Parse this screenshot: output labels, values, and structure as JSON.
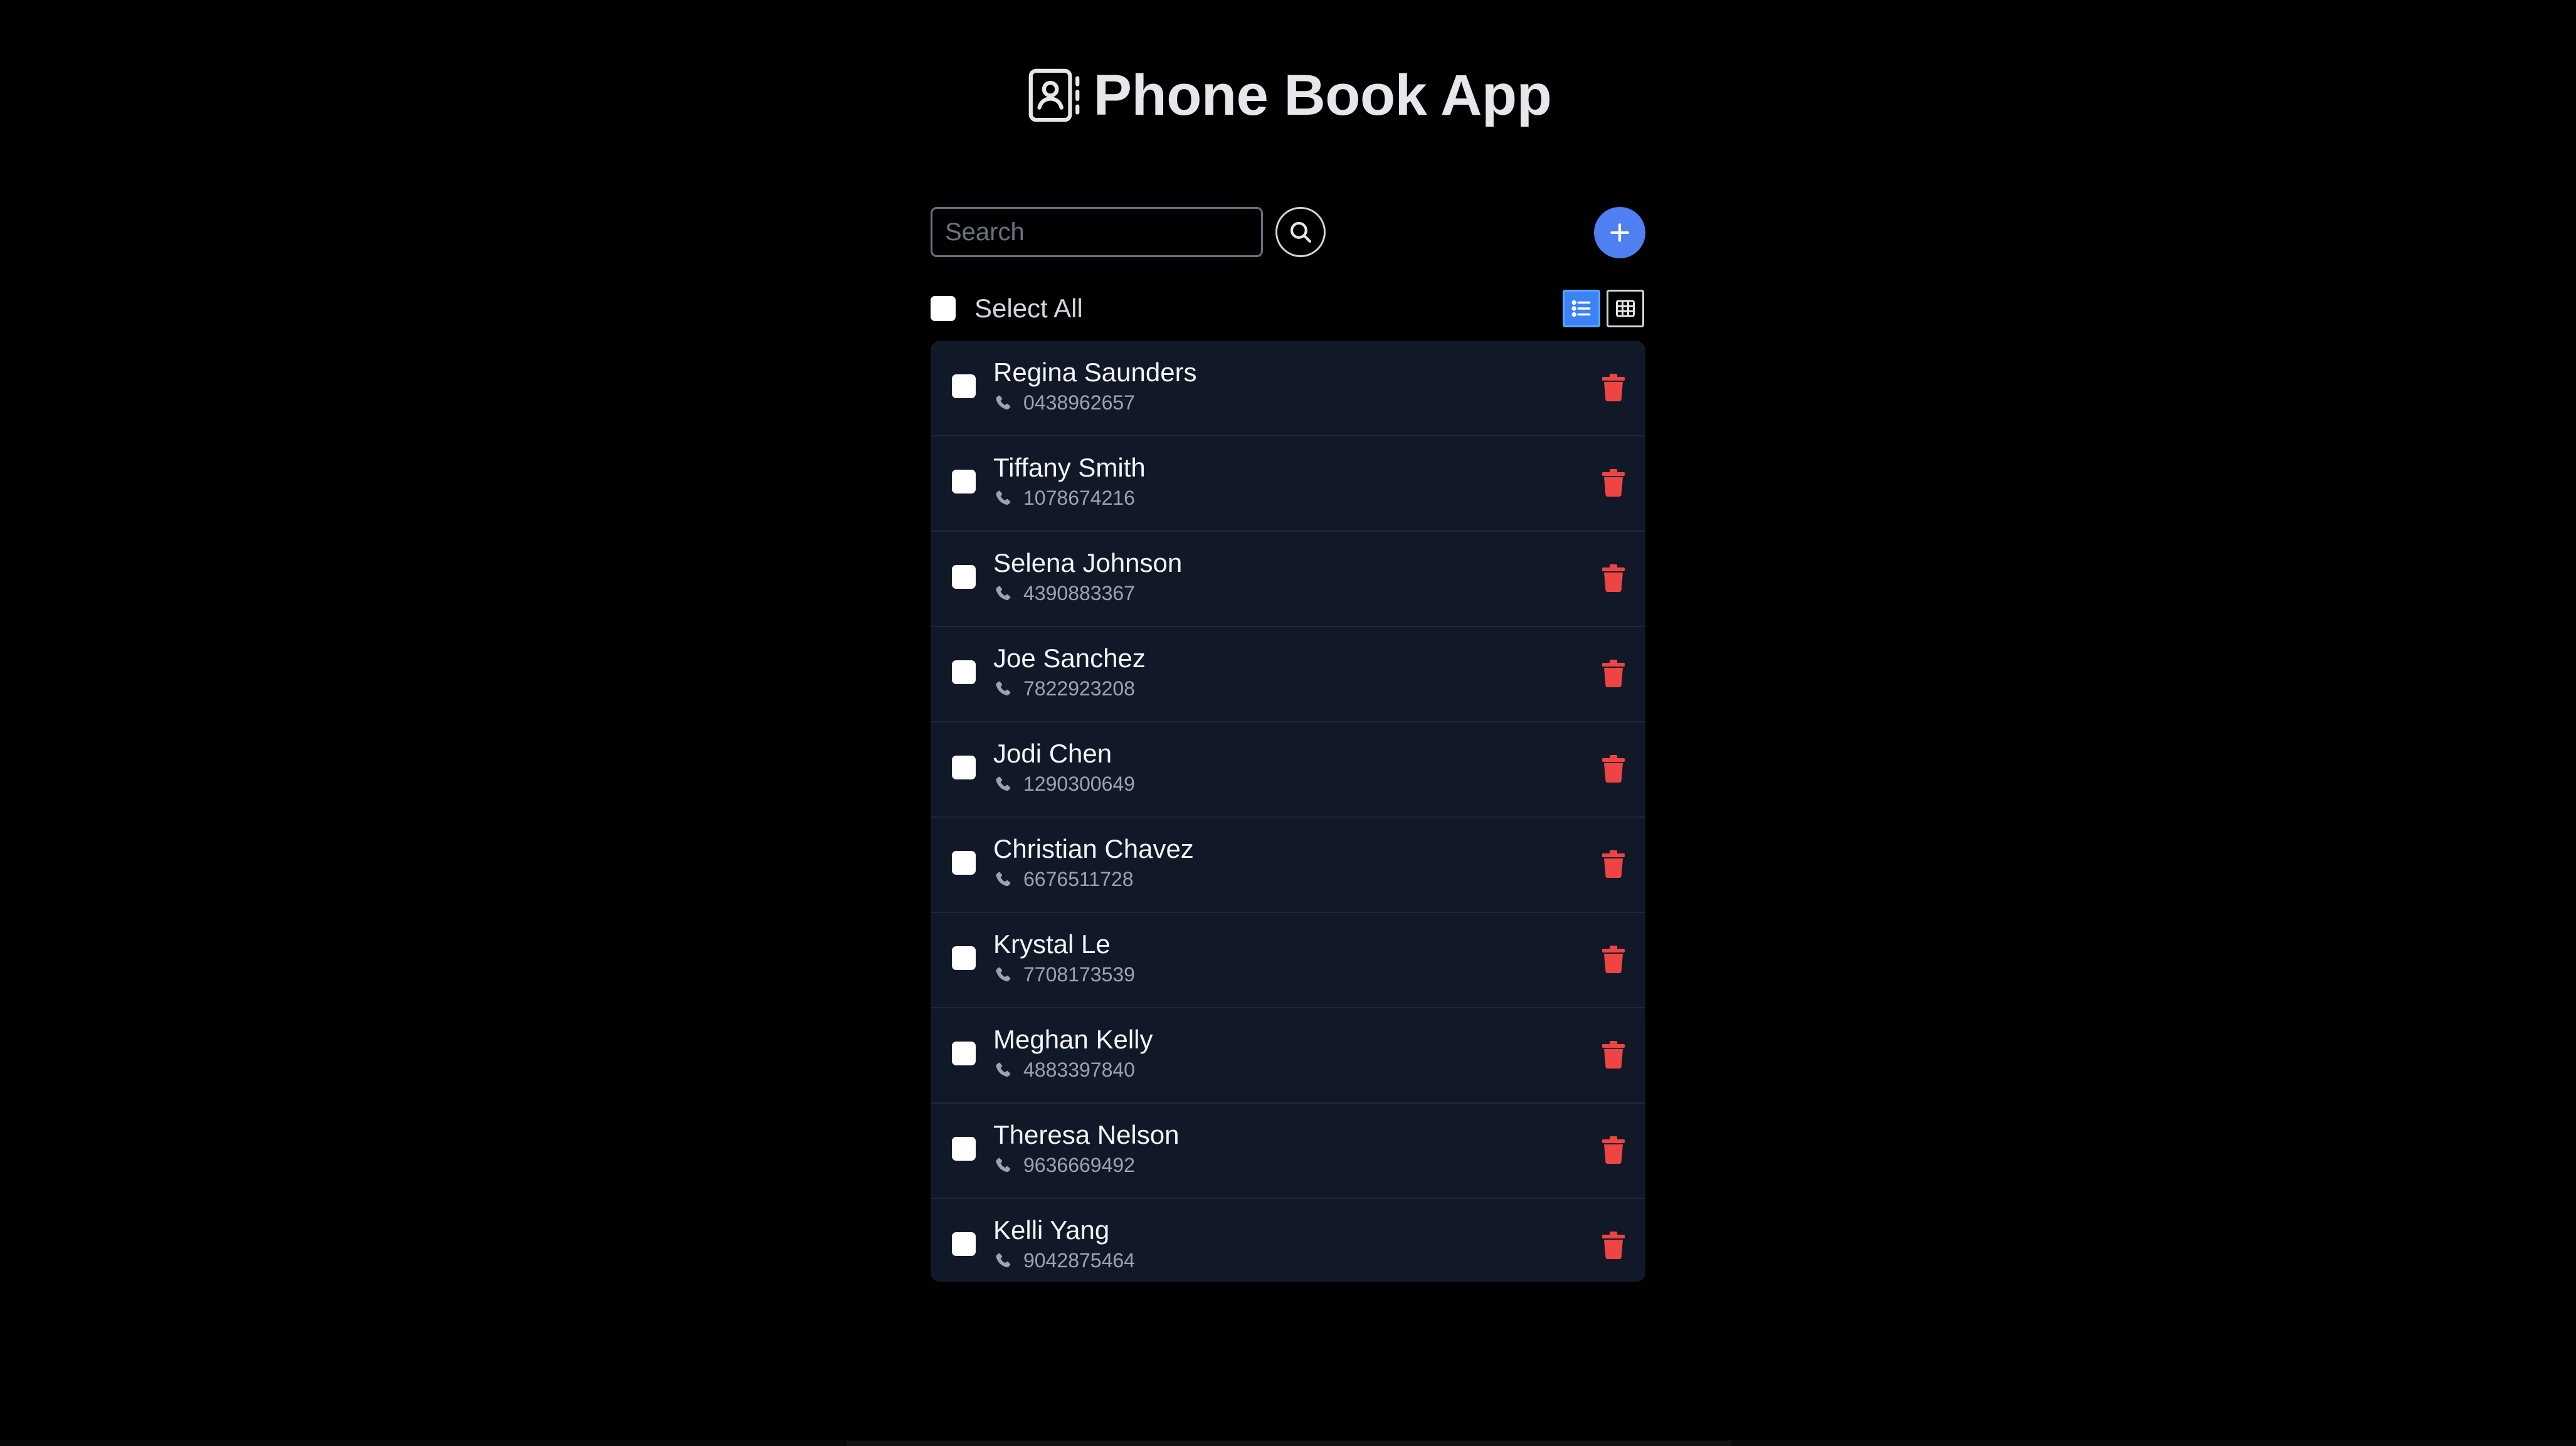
{
  "app": {
    "title": "Phone Book App",
    "icon": "contact-book-icon"
  },
  "search": {
    "placeholder": "Search",
    "value": "",
    "button_icon": "search-icon"
  },
  "add_button": {
    "icon": "plus-icon"
  },
  "select_all": {
    "label": "Select All",
    "checked": false
  },
  "view_toggle": {
    "active": "list",
    "options": [
      "list-icon",
      "grid-icon"
    ]
  },
  "contacts": [
    {
      "name": "Regina Saunders",
      "phone": "0438962657"
    },
    {
      "name": "Tiffany Smith",
      "phone": "1078674216"
    },
    {
      "name": "Selena Johnson",
      "phone": "4390883367"
    },
    {
      "name": "Joe Sanchez",
      "phone": "7822923208"
    },
    {
      "name": "Jodi Chen",
      "phone": "1290300649"
    },
    {
      "name": "Christian Chavez",
      "phone": "6676511728"
    },
    {
      "name": "Krystal Le",
      "phone": "7708173539"
    },
    {
      "name": "Meghan Kelly",
      "phone": "4883397840"
    },
    {
      "name": "Theresa Nelson",
      "phone": "9636669492"
    },
    {
      "name": "Kelli Yang",
      "phone": "9042875464"
    }
  ],
  "colors": {
    "background": "#000000",
    "card": "#111827",
    "accent": "#4f7ff0",
    "delete": "#ef4444",
    "text_primary": "#f3f4f6",
    "text_secondary": "#9ca3af"
  }
}
